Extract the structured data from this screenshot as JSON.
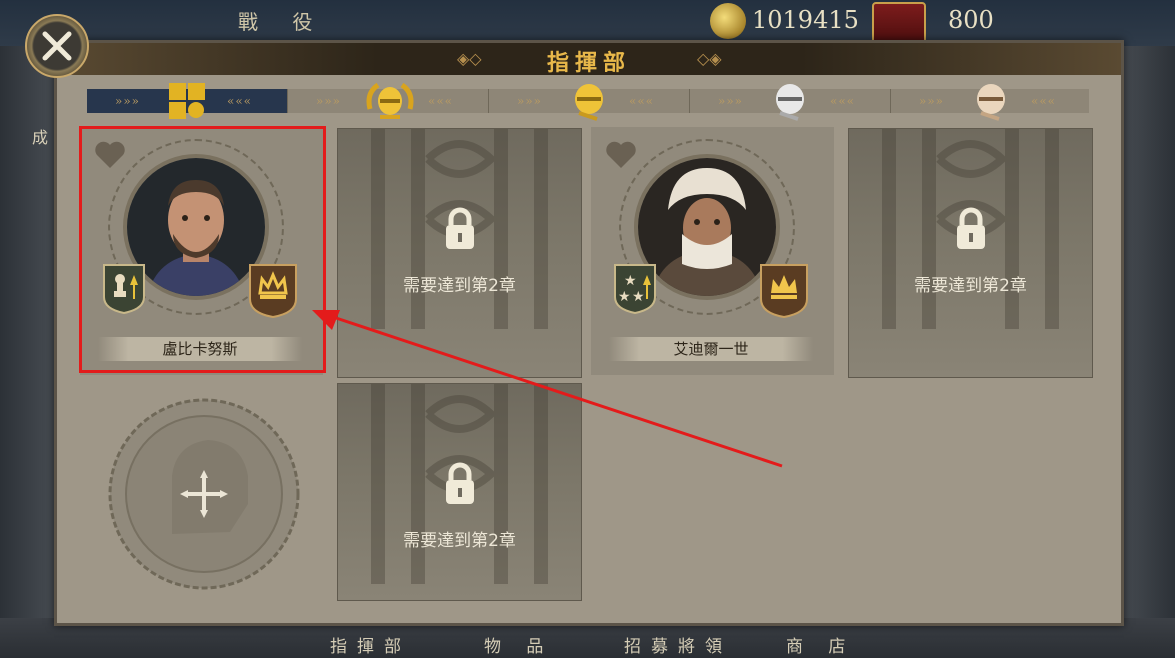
{
  "top_bar": {
    "section_label": "戰 役",
    "coins": "1019415",
    "crowns": "800",
    "side_label": "成"
  },
  "panel": {
    "title": "指揮部"
  },
  "tabs": [
    {
      "icon": "grid-icon",
      "active": true
    },
    {
      "icon": "gold-laurel-helmet-icon",
      "active": false
    },
    {
      "icon": "gold-helmet-icon",
      "active": false
    },
    {
      "icon": "silver-helmet-icon",
      "active": false
    },
    {
      "icon": "bronze-helmet-icon",
      "active": false
    }
  ],
  "cards": {
    "hero1": {
      "name": "盧比卡努斯"
    },
    "hero2": {
      "name": "艾迪爾一世"
    },
    "locked_text": "需要達到第2章"
  },
  "bottom_nav": [
    "指揮部",
    "物 品",
    "招募將領",
    "商 店"
  ],
  "colors": {
    "accent": "#e8b84a",
    "highlight": "#e31b1b"
  }
}
